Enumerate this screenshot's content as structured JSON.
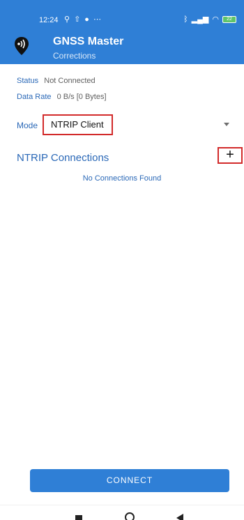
{
  "statusbar": {
    "time": "12:24",
    "left_icons": [
      "walk-icon",
      "upload-icon",
      "app-notification-icon",
      "more-icon"
    ],
    "right_icons": [
      "bluetooth-icon",
      "signal-icon",
      "wifi-icon",
      "battery-icon"
    ],
    "battery_level": "22"
  },
  "app_bar": {
    "title": "GNSS Master",
    "subtitle": "Corrections",
    "logo": "signal-pin-logo"
  },
  "info": {
    "status_label": "Status",
    "status_value": "Not Connected",
    "data_rate_label": "Data Rate",
    "data_rate_value": "0 B/s [0 Bytes]"
  },
  "mode": {
    "label": "Mode",
    "selected": "NTRIP Client"
  },
  "connections": {
    "title": "NTRIP Connections",
    "add_label": "+",
    "empty_message": "No Connections Found"
  },
  "actions": {
    "connect_label": "CONNECT"
  },
  "colors": {
    "primary": "#2f7fd6",
    "accent_text": "#2a68b7",
    "highlight_border": "#d22a2a"
  }
}
